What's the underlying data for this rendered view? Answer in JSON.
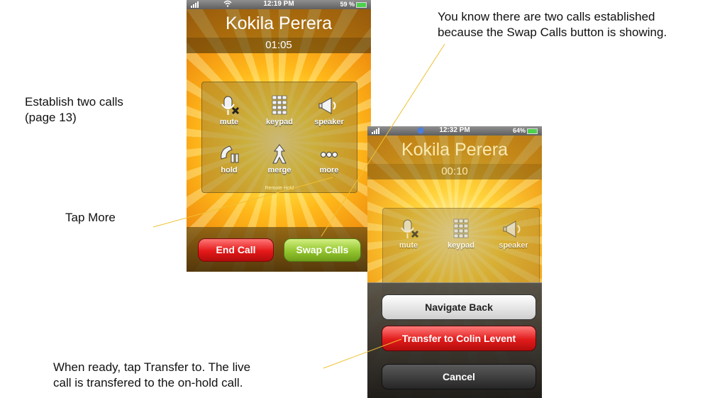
{
  "annotations": {
    "swap_note_line1": "You know there are two calls established",
    "swap_note_line2": "because the Swap Calls button is showing.",
    "establish_line1": "Establish two calls",
    "establish_line2": "(page 13)",
    "tap_more": "Tap More",
    "transfer_line1": "When ready, tap Transfer to. The live",
    "transfer_line2": "call is transfered to the on-hold call."
  },
  "phone1": {
    "status_time": "12:19 PM",
    "battery": "59 %",
    "contact_name": "Kokila Perera",
    "call_duration": "01:05",
    "buttons": {
      "mute": "mute",
      "keypad": "keypad",
      "speaker": "speaker",
      "hold": "hold",
      "merge": "merge",
      "more": "more"
    },
    "remote_hold": "Remote Hold",
    "end_call": "End Call",
    "swap_calls": "Swap Calls"
  },
  "phone2": {
    "status_time": "12:32 PM",
    "battery": "64%",
    "contact_name": "Kokila Perera",
    "call_duration": "00:10",
    "buttons": {
      "mute": "mute",
      "keypad": "keypad",
      "speaker": "speaker"
    },
    "sheet": {
      "navigate_back": "Navigate Back",
      "transfer": "Transfer to Colin Levent",
      "cancel": "Cancel"
    }
  },
  "colors": {
    "end_call_red": "#e41818",
    "swap_green": "#93c52e",
    "sunburst_yellow": "#ffd23a"
  }
}
